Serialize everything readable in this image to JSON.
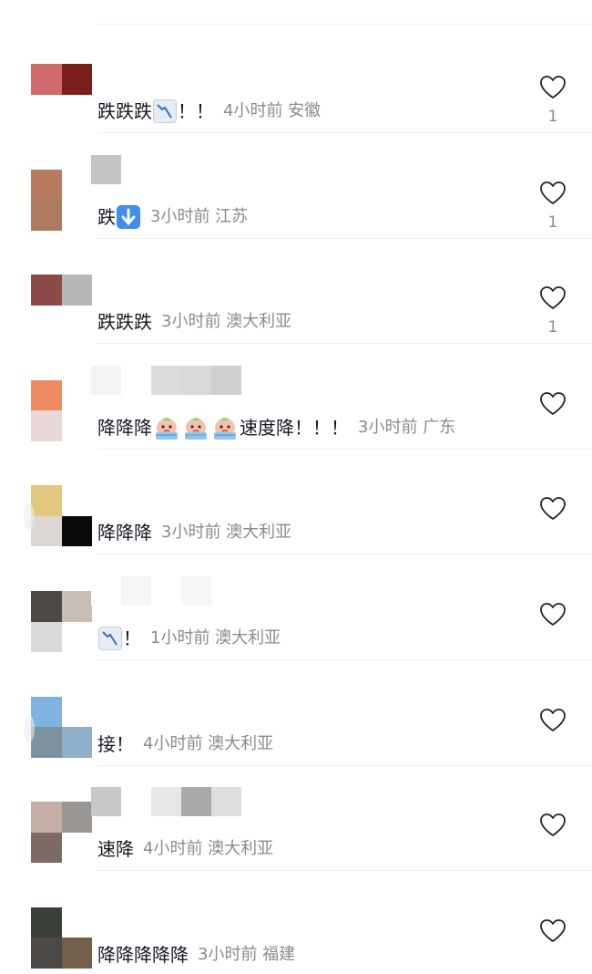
{
  "comments": [
    {
      "text": "跌跌跌",
      "emoji": [
        "chart-down-icon"
      ],
      "suffix": "！！",
      "time": "4小时前",
      "location": "安徽",
      "likes": "1",
      "avatar": [
        "#cf6b6a",
        "#7a1f1a",
        "#ffffff",
        "#ffffff"
      ],
      "name_blur": []
    },
    {
      "text": "跌",
      "emoji": [
        "arrow-down-icon"
      ],
      "suffix": "",
      "time": "3小时前",
      "location": "江苏",
      "likes": "1",
      "avatar": [
        "#b87a5e",
        "#ffffff",
        "#ad7a60",
        "#ffffff"
      ],
      "name_blur": [
        "#c4c4c4",
        "#ffffff",
        "#ffffff",
        "#ffffff"
      ]
    },
    {
      "text": "跌跌跌",
      "emoji": [],
      "suffix": "",
      "time": "3小时前",
      "location": "澳大利亚",
      "likes": "1",
      "avatar": [
        "#8b4a45",
        "#b7b7b5",
        "#ffffff",
        "#ffffff"
      ],
      "name_blur": []
    },
    {
      "text": "降降降",
      "emoji": [
        "crying-face-icon",
        "crying-face-icon",
        "crying-face-icon"
      ],
      "suffix": "速度降！！！",
      "time": "3小时前",
      "location": "广东",
      "likes": "",
      "avatar": [
        "#ef8b63",
        "#ffffff",
        "#ead7d8",
        "#ffffff"
      ],
      "name_blur": [
        "#f4f4f4",
        "#ffffff",
        "#dcdcdc",
        "#d9d9d9",
        "#cfcfcf"
      ]
    },
    {
      "text": "降降降",
      "emoji": [],
      "suffix": "",
      "time": "3小时前",
      "location": "澳大利亚",
      "likes": "",
      "avatar": [
        "#e3c77f",
        "#ffffff",
        "#dcd7d3",
        "#0a0a0a"
      ],
      "name_blur": []
    },
    {
      "text": "",
      "emoji": [
        "chart-down-icon"
      ],
      "suffix": "！",
      "time": "1小时前",
      "location": "澳大利亚",
      "likes": "",
      "avatar": [
        "#4e4844",
        "#c8beb6",
        "#d9d9d9",
        "#ffffff"
      ],
      "name_blur": [
        "#ffffff",
        "#f6f6f6",
        "#ffffff",
        "#f7f7f7"
      ]
    },
    {
      "text": "接！",
      "emoji": [],
      "suffix": "",
      "time": "4小时前",
      "location": "澳大利亚",
      "likes": "",
      "avatar": [
        "#7fb3e0",
        "#ffffff",
        "#7d929f",
        "#8fb0c8"
      ],
      "name_blur": []
    },
    {
      "text": "速降",
      "emoji": [],
      "suffix": "",
      "time": "4小时前",
      "location": "澳大利亚",
      "likes": "",
      "avatar": [
        "#c5aea3",
        "#9a9693",
        "#7b6b64",
        "#ffffff"
      ],
      "name_blur": [
        "#c8c8c8",
        "#ffffff",
        "#e7e7e7",
        "#a9a9a9",
        "#dedede"
      ]
    },
    {
      "text": "降降降降降",
      "emoji": [],
      "suffix": "",
      "time": "3小时前",
      "location": "福建",
      "likes": "",
      "avatar": [
        "#3b3f3a",
        "#ffffff",
        "#4c4845",
        "#735f49"
      ],
      "name_blur": []
    }
  ]
}
